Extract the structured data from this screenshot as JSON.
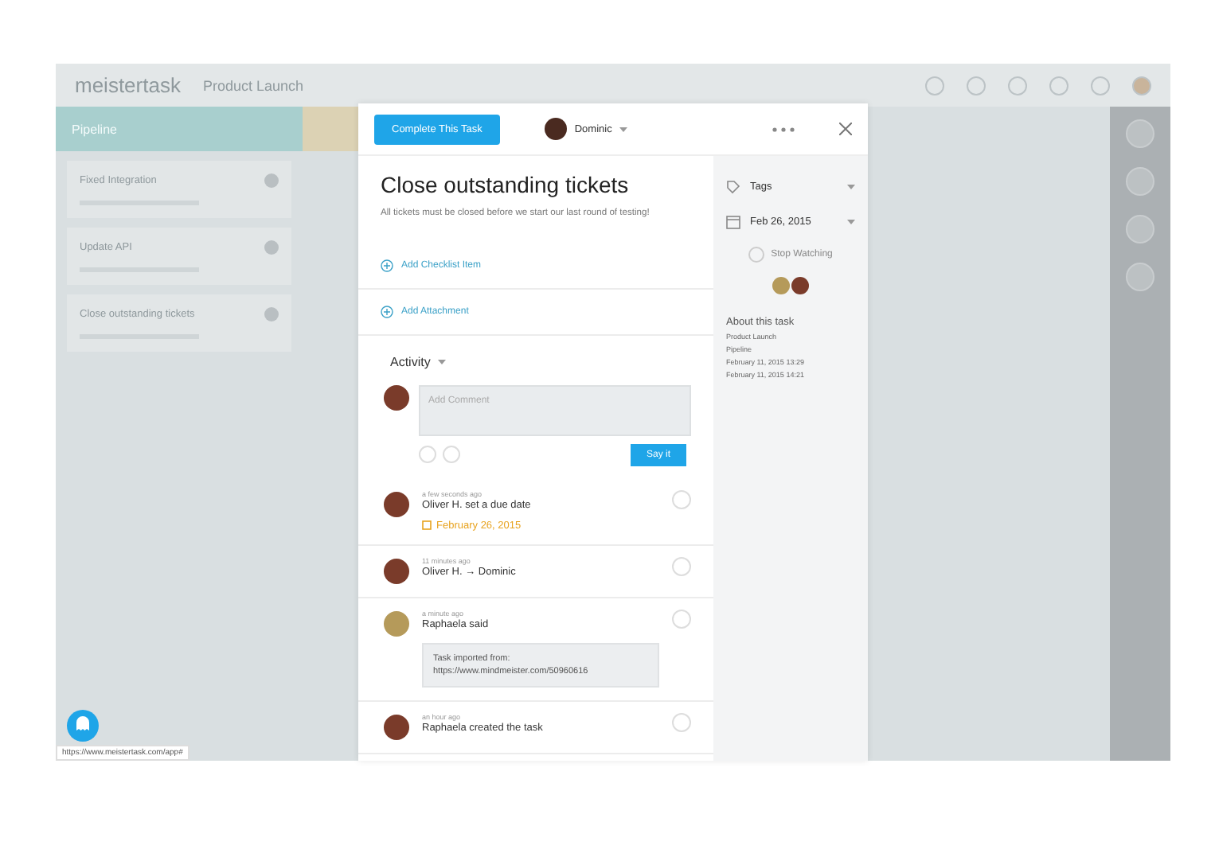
{
  "app": {
    "logo": "meistertask",
    "project": "Product Launch"
  },
  "columns": [
    {
      "title": "Pipeline",
      "cards": [
        {
          "title": "Fixed Integration"
        },
        {
          "title": "Update API"
        },
        {
          "title": "Close outstanding tickets"
        }
      ]
    }
  ],
  "task": {
    "complete_button": "Complete This Task",
    "assignee": "Dominic",
    "title": "Close outstanding tickets",
    "description": "All tickets must be closed before we start our last round of testing!",
    "actions": [
      "Add Checklist Item",
      "Add Attachment"
    ],
    "activity_label": "Activity",
    "comment": {
      "placeholder": "Add Comment",
      "button": "Say it"
    },
    "activities": [
      {
        "kind": "event",
        "time": "a few seconds ago",
        "text": "Oliver H. set a due date",
        "date": "February 26, 2015"
      },
      {
        "kind": "event",
        "time": "11 minutes ago",
        "text": "Oliver H. → Dominic"
      },
      {
        "kind": "comment",
        "time": "a minute ago",
        "text": "Raphaela said",
        "quote": "Task imported from: https://www.mindmeister.com/50960616"
      },
      {
        "kind": "event",
        "time": "an hour ago",
        "text": "Raphaela created the task"
      }
    ],
    "sidebar": {
      "tags": "Tags",
      "due_date": "Feb 26, 2015",
      "watch": "Stop Watching",
      "about_title": "About this task",
      "about_lines": [
        "Product Launch",
        "Pipeline",
        "February 11, 2015 13:29",
        "February 11, 2015 14:21"
      ]
    }
  },
  "status_url": "https://www.meistertask.com/app#"
}
